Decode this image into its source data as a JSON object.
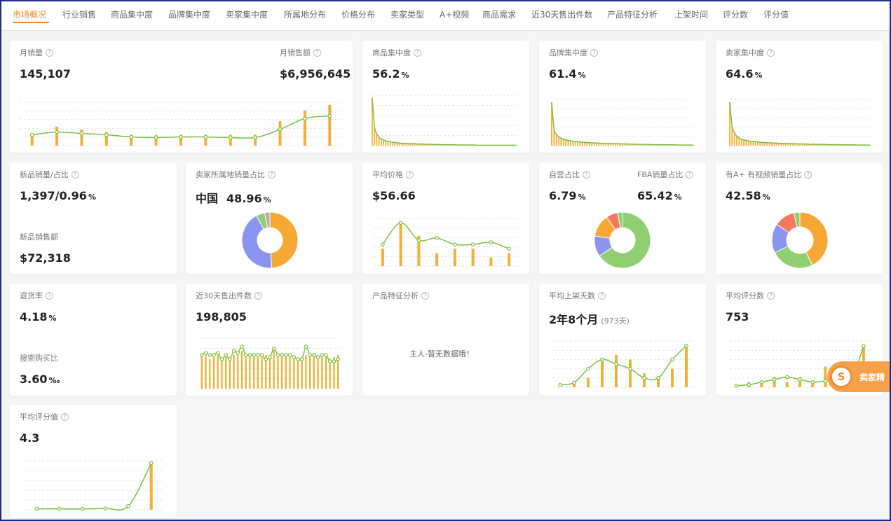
{
  "tabs": [
    "市场概况",
    "行业销售",
    "商品集中度",
    "品牌集中度",
    "卖家集中度",
    "所属地分布",
    "价格分布",
    "卖家类型",
    "A+视频",
    "商品需求",
    "近30天售出件数",
    "产品特征分析",
    "上架时间",
    "评分数",
    "评分值"
  ],
  "active_tab": 0,
  "colors": {
    "accent": "#f08c2a",
    "bar": "#f2b134",
    "line": "#7ac143",
    "grid": "#e3e3e3",
    "pie_orange": "#f7a733",
    "pie_blue": "#8c94f0",
    "pie_green": "#8fcf72",
    "pie_red": "#f47a5f"
  },
  "cards": {
    "monthly": {
      "label1": "月销量",
      "value1": "145,107",
      "label2": "月销售额",
      "value2": "$6,956,645"
    },
    "product_conc": {
      "label": "商品集中度",
      "value": "56.2",
      "unit": "%"
    },
    "brand_conc": {
      "label": "品牌集中度",
      "value": "61.4",
      "unit": "%"
    },
    "seller_conc": {
      "label": "卖家集中度",
      "value": "64.6",
      "unit": "%"
    },
    "new_product": {
      "label1": "新品销量/占比",
      "value1": "1,397/0.96",
      "unit1": "%",
      "label2": "新品销售额",
      "value2": "$72,318"
    },
    "seller_location": {
      "label": "卖家所属地销量占比",
      "region": "中国",
      "value": "48.96",
      "unit": "%"
    },
    "avg_price": {
      "label": "平均价格",
      "value": "$56.66"
    },
    "self_fba": {
      "label1": "自营占比",
      "value1": "6.79",
      "unit1": "%",
      "label2": "FBA销量占比",
      "value2": "65.42",
      "unit2": "%"
    },
    "aplus": {
      "label": "有A+ 有视频销量占比",
      "value": "42.58",
      "unit": "%"
    },
    "return_rate": {
      "label1": "退货率",
      "value1": "4.18",
      "unit1": "%",
      "label2": "搜索购买比",
      "value2": "3.60",
      "unit2": "‰"
    },
    "sold30": {
      "label": "近30天售出件数",
      "value": "198,805"
    },
    "features": {
      "label": "产品特征分析",
      "empty_text": "主人-暂无数据哦！"
    },
    "listing_days": {
      "label": "平均上架天数",
      "value": "2年8个月",
      "sub": "(973天)"
    },
    "review_count": {
      "label": "平均评分数",
      "value": "753"
    },
    "rating": {
      "label": "平均评分值",
      "value": "4.3"
    }
  },
  "badge": {
    "text": "卖家精",
    "logo_char": "S"
  },
  "chart_data": [
    {
      "id": "monthly",
      "type": "bar+line",
      "bars": [
        4,
        7,
        6,
        5,
        4,
        4,
        4,
        4,
        4,
        4,
        9,
        13,
        15
      ],
      "line": [
        4,
        5,
        4.5,
        4,
        3.2,
        3,
        3.2,
        3.2,
        3,
        3,
        6,
        10,
        11
      ],
      "ylim": [
        0,
        16
      ]
    },
    {
      "id": "product_conc",
      "type": "area",
      "values": [
        100,
        40,
        25,
        18,
        14,
        12,
        10,
        9,
        8,
        7,
        6.5,
        6,
        5.5,
        5,
        5,
        4.5,
        4.5,
        4,
        4,
        4,
        3.5,
        3.5,
        3.5,
        3,
        3,
        3,
        3,
        2.5,
        2.5,
        2.5,
        2.5,
        2,
        2,
        2,
        2,
        2,
        2,
        2,
        1.5,
        1.5,
        1.5,
        1.5,
        1.5,
        1.5,
        1.5,
        1.5,
        1,
        1,
        1,
        1,
        1,
        1,
        1,
        1,
        1,
        1,
        1,
        1,
        1,
        1,
        1,
        1,
        1,
        1,
        0.5
      ]
    },
    {
      "id": "brand_conc",
      "type": "area",
      "values": [
        100,
        38,
        26,
        20,
        17,
        15,
        13,
        12,
        11,
        10,
        9.5,
        9,
        8.5,
        8,
        7.5,
        7,
        7,
        6.5,
        6.5,
        6,
        6,
        5.5,
        5.5,
        5,
        5,
        5,
        4.5,
        4.5,
        4.5,
        4,
        4,
        4,
        4,
        3.5,
        3.5,
        3.5,
        3.5,
        3,
        3,
        3,
        3,
        3,
        2.5,
        2.5,
        2.5,
        2.5,
        2.5,
        2,
        2,
        2,
        2,
        2,
        2,
        2,
        1.5,
        1.5,
        1.5,
        1.5,
        1.5,
        1.5,
        1.5
      ]
    },
    {
      "id": "seller_conc",
      "type": "area",
      "values": [
        100,
        45,
        30,
        22,
        18,
        15,
        13,
        12,
        11,
        10,
        9.5,
        9,
        8.5,
        8,
        7.5,
        7,
        7,
        6.5,
        6.5,
        6,
        6,
        5.5,
        5.5,
        5,
        5,
        5,
        4.5,
        4.5,
        4.5,
        4,
        4,
        4,
        4,
        3.5,
        3.5,
        3.5,
        3.5,
        3,
        3,
        3,
        3,
        3,
        2.5,
        2.5,
        2.5,
        2.5,
        2.5,
        2,
        2,
        2,
        2,
        2,
        2,
        2,
        1.5,
        1.5,
        1.5,
        1.5,
        1.5,
        1.5,
        1.5
      ]
    },
    {
      "id": "seller_location",
      "type": "pie",
      "values": [
        48.96,
        43,
        5,
        3.04
      ],
      "colors": [
        "#f7a733",
        "#8c94f0",
        "#8fcf72",
        "#b0b0b0"
      ]
    },
    {
      "id": "avg_price",
      "type": "bar+line",
      "bars": [
        4,
        10,
        7,
        3,
        4,
        4,
        2,
        3
      ],
      "line": [
        5,
        10,
        6,
        6.5,
        5,
        5,
        5.5,
        4
      ],
      "ylim": [
        0,
        11
      ]
    },
    {
      "id": "self_fba",
      "type": "pie",
      "values": [
        65.42,
        12,
        13,
        6.79,
        2.79
      ],
      "colors": [
        "#8fcf72",
        "#8c94f0",
        "#f7a733",
        "#f47a5f",
        "#8fcf72"
      ]
    },
    {
      "id": "aplus",
      "type": "pie",
      "values": [
        42.58,
        25,
        17,
        12,
        3.42
      ],
      "colors": [
        "#f7a733",
        "#8fcf72",
        "#8c94f0",
        "#f47a5f",
        "#8fcf72"
      ]
    },
    {
      "id": "sold30",
      "type": "bar+line",
      "bars": [
        8,
        8,
        7,
        7.5,
        8,
        7,
        8,
        6.5,
        8,
        8,
        9,
        8,
        8,
        7.5,
        8,
        7.5,
        8,
        8,
        9,
        8,
        8,
        7.5,
        8,
        7.5,
        6.5,
        7,
        8,
        8,
        8.5,
        8,
        8,
        8,
        7,
        7.5,
        8
      ],
      "line": [
        8,
        8.5,
        8,
        8,
        8.5,
        7,
        8,
        7,
        9,
        8.5,
        10,
        8,
        8,
        8,
        8,
        8,
        7,
        7.5,
        9.5,
        8,
        8,
        8,
        8,
        7.5,
        7,
        7,
        10,
        8,
        8,
        7.5,
        8,
        8,
        6.5,
        6.5,
        7
      ],
      "ylim": [
        0,
        12
      ]
    },
    {
      "id": "listing_days",
      "type": "bar+line",
      "bars": [
        0,
        1,
        2,
        6,
        7,
        6,
        3,
        2,
        4,
        9
      ],
      "line": [
        0.5,
        1,
        4,
        6,
        5,
        4,
        2,
        2,
        6,
        9
      ],
      "ylim": [
        0,
        10
      ]
    },
    {
      "id": "review_count",
      "type": "bar+line",
      "bars": [
        0,
        1,
        1,
        2,
        1,
        2,
        1,
        4,
        1,
        2,
        8
      ],
      "line": [
        0.3,
        0.5,
        1,
        1.5,
        2,
        1.5,
        1,
        1.2,
        1.5,
        1.5,
        8
      ],
      "ylim": [
        0,
        9
      ]
    },
    {
      "id": "rating",
      "type": "bar+line",
      "bars": [
        0,
        0,
        0,
        0,
        0,
        10
      ],
      "line": [
        0.2,
        0.2,
        0.2,
        0.3,
        0.8,
        10
      ],
      "ylim": [
        0,
        10.5
      ]
    }
  ]
}
